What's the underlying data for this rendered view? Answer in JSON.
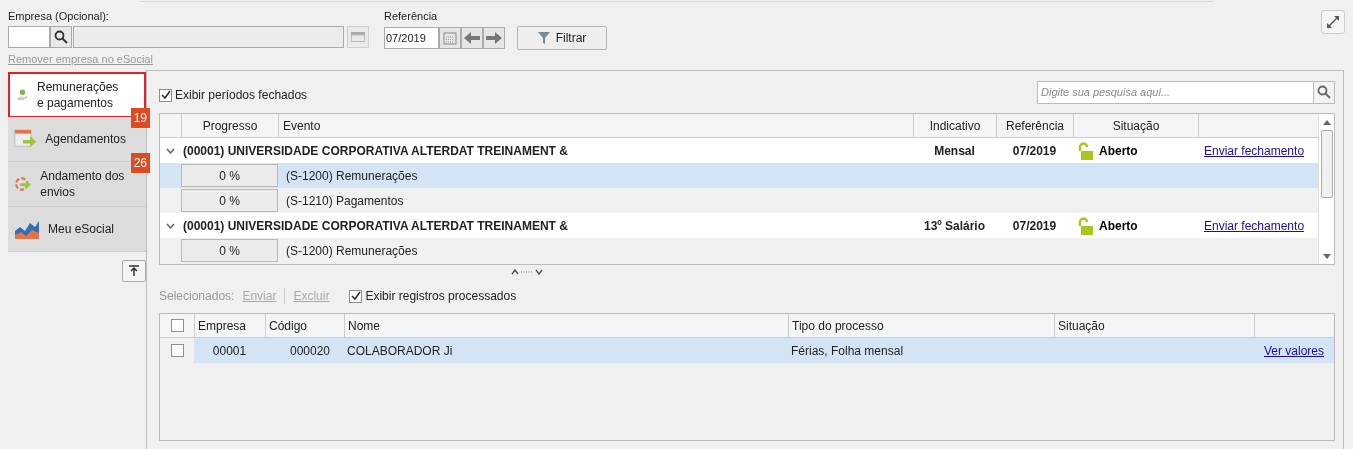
{
  "filters": {
    "empresa_label": "Empresa (Opcional):",
    "remove_link": "Remover empresa no eSocial",
    "referencia_label": "Referência",
    "referencia_value": "07/2019",
    "filter_button": "Filtrar"
  },
  "sidebar": {
    "items": [
      {
        "label": "Remunerações e pagamentos",
        "selected": true,
        "badge": "19"
      },
      {
        "label": "Agendamentos",
        "selected": false,
        "badge": "26"
      },
      {
        "label": "Andamento dos envios",
        "selected": false
      },
      {
        "label": "Meu eSocial",
        "selected": false
      }
    ]
  },
  "periods": {
    "show_closed": {
      "label": "Exibir períodos fechados",
      "checked": true
    },
    "search": {
      "placeholder": "Digite sua pesquisa aqui..."
    },
    "columns": [
      "Progresso",
      "Evento",
      "Indicativo",
      "Referência",
      "Situação"
    ],
    "groups": [
      {
        "title": "(00001) UNIVERSIDADE CORPORATIVA ALTERDAT TREINAMENT &",
        "expanded": true,
        "indicativo": "Mensal",
        "referencia": "07/2019",
        "status": "Aberto",
        "action": "Enviar fechamento",
        "children": [
          {
            "progress": "0 %",
            "event": "(S-1200) Remunerações",
            "selected": true
          },
          {
            "progress": "0 %",
            "event": "(S-1210) Pagamentos",
            "selected": false
          }
        ]
      },
      {
        "title": "(00001) UNIVERSIDADE CORPORATIVA ALTERDAT TREINAMENT &",
        "expanded": true,
        "indicativo": "13º Salário",
        "referencia": "07/2019",
        "status": "Aberto",
        "action": "Enviar fechamento",
        "children": [
          {
            "progress": "0 %",
            "event": "(S-1200) Remunerações",
            "selected": false
          }
        ]
      }
    ]
  },
  "records": {
    "selected_label": "Selecionados:",
    "actions": [
      {
        "label": "Enviar",
        "disabled": true
      },
      {
        "label": "Excluir",
        "disabled": true
      }
    ],
    "show_processed": {
      "label": "Exibir registros processados",
      "checked": true
    },
    "select_all": {
      "checked": false
    },
    "columns": [
      "Empresa",
      "Código",
      "Nome",
      "Tipo do processo",
      "Situação"
    ],
    "rows": [
      {
        "checked": false,
        "selected": true,
        "empresa": "00001",
        "codigo": "000020",
        "nome": "COLABORADOR Ji",
        "tipo": "Férias, Folha mensal",
        "action": "Ver valores"
      }
    ]
  }
}
